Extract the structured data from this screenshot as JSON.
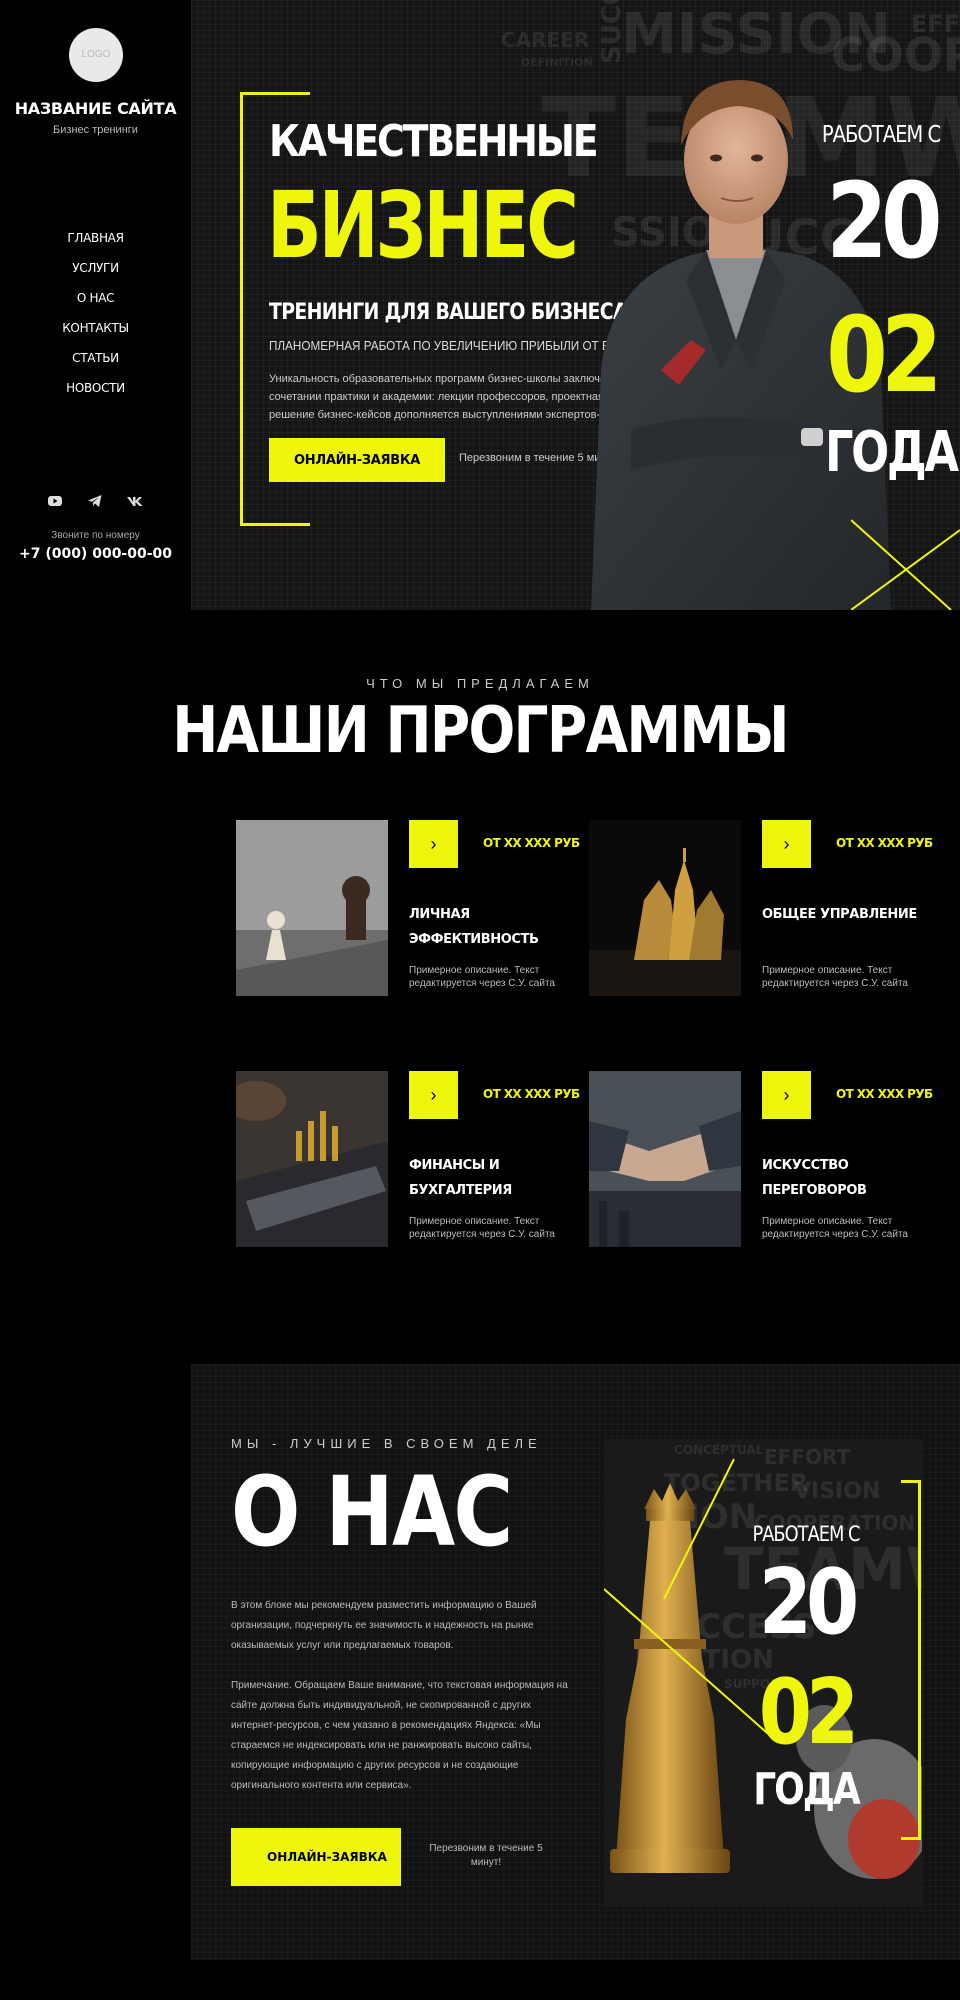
{
  "brand": {
    "logo_text": "LOGO",
    "name": "НАЗВАНИЕ САЙТА",
    "tagline": "Бизнес тренинги"
  },
  "nav": {
    "items": [
      "ГЛАВНАЯ",
      "УСЛУГИ",
      "О НАС",
      "КОНТАКТЫ",
      "СТАТЬИ",
      "НОВОСТИ"
    ]
  },
  "socials": [
    "youtube-icon",
    "telegram-icon",
    "vk-icon"
  ],
  "contact": {
    "label": "Звоните по номеру",
    "phone": "+7 (000) 000-00-00"
  },
  "hero": {
    "line1": "КАЧЕСТВЕННЫЕ",
    "line2": "БИЗНЕС",
    "line3": "ТРЕНИНГИ ДЛЯ ВАШЕГО БИЗНЕСА",
    "line4": "ПЛАНОМЕРНАЯ РАБОТА ПО УВЕЛИЧЕНИЮ ПРИБЫЛИ ОТ БИЗНЕСА!",
    "description": "Уникальность образовательных программ бизнес-школы заключается в сочетании практики и академии: лекции профессоров, проектная работа и решение бизнес-кейсов дополняется выступлениями экспертов-практиков.",
    "button": "ОНЛАЙН-ЗАЯВКА",
    "callback": "Перезвоним в течение 5 минут!",
    "since_label": "РАБОТАЕМ С",
    "year_part1": "20",
    "year_part2": "02",
    "year_suffix": "ГОДА",
    "bg_words": [
      "CAREER",
      "MISSION",
      "SUCC",
      "EFFORT",
      "COOP",
      "TEAMWO",
      "DEFINITION",
      "SSION",
      "SUCC"
    ]
  },
  "programs": {
    "kicker": "ЧТО МЫ ПРЕДЛАГАЕМ",
    "title": "НАШИ ПРОГРАММЫ",
    "arrow": "›",
    "cards": [
      {
        "price": "ОТ XX XXX РУБ",
        "title": "ЛИЧНАЯ ЭФФЕКТИВНОСТЬ",
        "description": "Примерное описание. Текст редактируется через С.У. сайта"
      },
      {
        "price": "ОТ XX XXX РУБ",
        "title": "ОБЩЕЕ УПРАВЛЕНИЕ",
        "description": "Примерное описание. Текст редактируется через С.У. сайта"
      },
      {
        "price": "ОТ XX XXX РУБ",
        "title": "ФИНАНСЫ И БУХГАЛТЕРИЯ",
        "description": "Примерное описание. Текст редактируется через С.У. сайта"
      },
      {
        "price": "ОТ XX XXX РУБ",
        "title": "ИСКУССТВО ПЕРЕГОВОРОВ",
        "description": "Примерное описание. Текст редактируется через С.У. сайта"
      }
    ]
  },
  "about": {
    "kicker": "МЫ - ЛУЧШИЕ В СВОЕМ ДЕЛЕ",
    "title": "О НАС",
    "paragraph1": "В этом блоке мы рекомендуем разместить информацию о Вашей организации, подчеркнуть ее значимость и надежность на рынке оказываемых услуг или предлагаемых товаров.",
    "paragraph2": "Примечание. Обращаем Ваше внимание, что текстовая информация на сайте должна быть индивидуальной, не скопированной с других интернет-ресурсов, с чем указано в рекомендациях Яндекса: «Мы стараемся не индексировать или не ранжировать высоко сайты, копирующие информацию с других ресурсов и не создающие оригинального контента или сервиса».",
    "button": "ОНЛАЙН-ЗАЯВКА",
    "callback": "Перезвоним в течение 5 минут!",
    "since_label": "РАБОТАЕМ С",
    "year_part1": "20",
    "year_part2": "02",
    "year_suffix": "ГОДА",
    "bg_words": [
      "CONCEPTUAL",
      "TOGETHER",
      "EFFORT",
      "VISION",
      "TION",
      "COOPERATION",
      "TEAMWORK",
      "SUCCESS",
      "NICATION",
      "SUPPORT"
    ]
  },
  "colors": {
    "accent": "#eef60c",
    "background": "#000000",
    "panel": "#151515"
  }
}
